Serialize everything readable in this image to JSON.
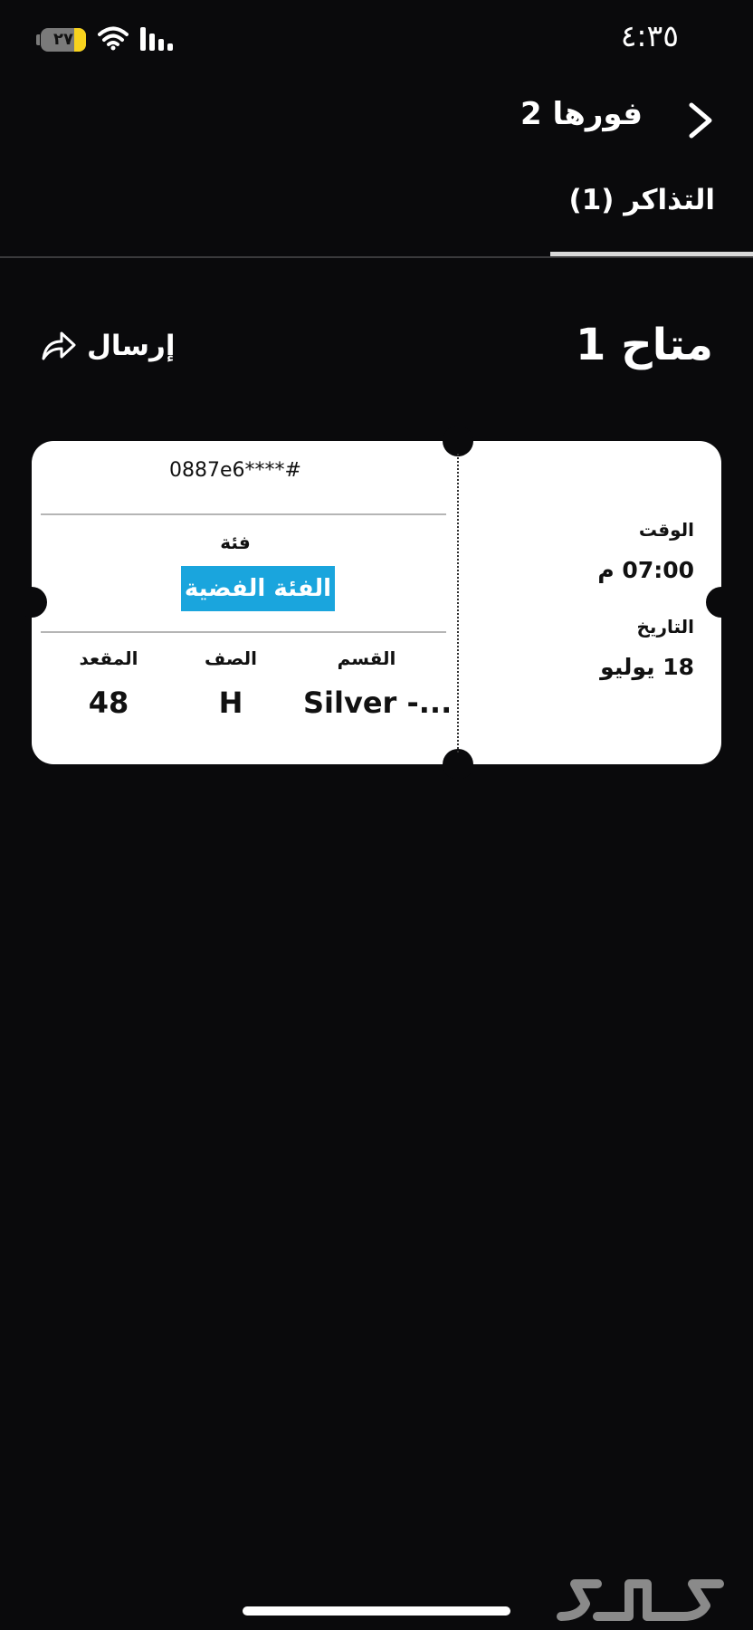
{
  "status_bar": {
    "time": "٤:٣٥",
    "battery": "٢٧",
    "battery_level": 0.27
  },
  "header": {
    "title": "فورها 2"
  },
  "tabs": [
    {
      "label": "التذاكر (1)",
      "active": true
    }
  ],
  "section": {
    "title": "متاح 1",
    "send_label": "إرسال"
  },
  "ticket": {
    "code": "0887e6****#",
    "category_label": "فئة",
    "category_value": "الفئة الفضية",
    "section_label": "القسم",
    "section_value": "Silver -...",
    "row_label": "الصف",
    "row_value": "H",
    "seat_label": "المقعد",
    "seat_value": "48",
    "time_label": "الوقت",
    "time_value": "07:00 م",
    "date_label": "التاريخ",
    "date_value": "18 يوليو"
  },
  "colors": {
    "background": "#0a0a0c",
    "ticket": "#ffffff",
    "category_badge": "#1aa5dd",
    "battery": "#f7d21d"
  },
  "icons": {
    "back": "chevron-right-icon",
    "share": "share-arrow-icon",
    "wifi": "wifi-icon",
    "signal": "cellular-signal-icon",
    "watermark": "haraj-logo"
  }
}
